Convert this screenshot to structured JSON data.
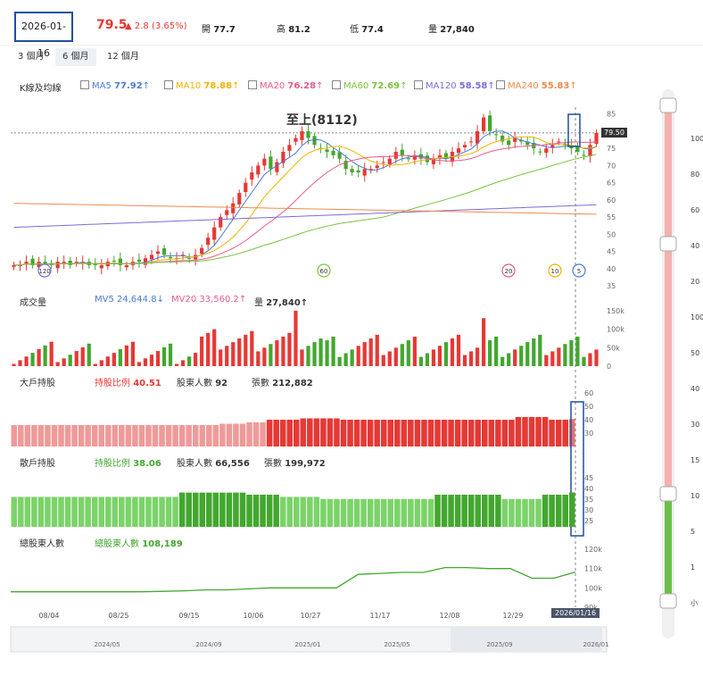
{
  "header": {
    "date": "2026-01-16",
    "price": "79.5",
    "change": "▲ 2.8 (3.65%)",
    "open_label": "開",
    "open": "77.7",
    "high_label": "高",
    "high": "81.2",
    "low_label": "低",
    "low": "77.4",
    "vol_label": "量",
    "volume": "27,840"
  },
  "tabs": [
    "3 個月",
    "6 個月",
    "12 個月"
  ],
  "active_tab": 1,
  "kline": {
    "label": "K線及均線",
    "ma": [
      {
        "name": "MA5",
        "value": "77.92",
        "arrow": "↑",
        "color": "#4a7bd6"
      },
      {
        "name": "MA10",
        "value": "78.88",
        "arrow": "↑",
        "color": "#f0b400"
      },
      {
        "name": "MA20",
        "value": "76.28",
        "arrow": "↑",
        "color": "#e85a8a"
      },
      {
        "name": "MA60",
        "value": "72.69",
        "arrow": "↑",
        "color": "#7cc23f"
      },
      {
        "name": "MA120",
        "value": "58.58",
        "arrow": "↑",
        "color": "#7d6bd9"
      },
      {
        "name": "MA240",
        "value": "55.83",
        "arrow": "↑",
        "color": "#f08a4b"
      }
    ],
    "annotation": "至上(8112)",
    "price_tag": "79.50",
    "yticks": [
      "85",
      "80",
      "75",
      "70",
      "65",
      "60",
      "55",
      "50",
      "45",
      "40",
      "35"
    ],
    "markers": [
      "120",
      "60",
      "20",
      "10",
      "5"
    ]
  },
  "volume": {
    "label": "成交量",
    "mv5_label": "MV5",
    "mv5": "24,644.8↓",
    "mv20_label": "MV20",
    "mv20": "33,560.2↑",
    "vol_label": "量",
    "vol": "27,840↑",
    "yticks": [
      "150k",
      "100k",
      "50k",
      "0"
    ]
  },
  "big": {
    "label": "大戶持股",
    "ratio_label": "持股比例",
    "ratio": "40.51",
    "holders_label": "股東人數",
    "holders": "92",
    "shares_label": "張數",
    "shares": "212,882",
    "yticks": [
      "60",
      "50",
      "40",
      "30"
    ]
  },
  "retail": {
    "label": "散戶持股",
    "ratio_label": "持股比例",
    "ratio": "38.06",
    "holders_label": "股東人數",
    "holders": "66,556",
    "shares_label": "張數",
    "shares": "199,972",
    "yticks": [
      "45",
      "40",
      "35",
      "30",
      "25"
    ]
  },
  "total": {
    "label": "總股東人數",
    "count_label": "總股東人數",
    "count": "108,189",
    "yticks": [
      "120k",
      "110k",
      "100k",
      "90k"
    ]
  },
  "xaxis": [
    "08/04",
    "08/25",
    "09/15",
    "10/06",
    "10/27",
    "11/17",
    "12/08",
    "12/29"
  ],
  "xaxis_current": "2026/01/16",
  "navigator": [
    "2024/05",
    "2024/09",
    "2025/01",
    "2025/05",
    "2025/09",
    "2026/01"
  ],
  "slider_ticks": [
    "100",
    "80",
    "60",
    "40",
    "20",
    "100",
    "50",
    "40",
    "30",
    "15",
    "10",
    "5",
    "1",
    "小"
  ],
  "chart_data": {
    "type": "candlestick",
    "title": "",
    "ylim": [
      35,
      87
    ],
    "price_series": [
      41,
      41,
      42,
      41,
      42,
      41,
      41,
      42,
      42,
      41,
      42,
      42,
      41,
      41,
      41,
      42,
      42,
      41,
      41,
      42,
      42,
      43,
      44,
      45,
      44,
      43,
      43,
      44,
      43,
      44,
      46,
      49,
      52,
      55,
      57,
      59,
      62,
      65,
      68,
      70,
      72,
      69,
      71,
      74,
      76,
      78,
      80,
      78,
      76,
      75,
      74,
      73,
      72,
      69,
      68,
      68,
      69,
      69,
      70,
      71,
      72,
      74,
      73,
      72,
      73,
      72,
      71,
      72,
      73,
      72,
      74,
      75,
      76,
      77,
      80,
      84,
      80,
      79,
      77,
      76,
      78,
      77,
      76,
      75,
      74,
      75,
      76,
      77,
      76,
      75,
      74,
      73,
      76,
      79.5
    ],
    "ma_values": {
      "MA5": 77.92,
      "MA10": 78.88,
      "MA20": 76.28,
      "MA60": 72.69,
      "MA120": 58.58,
      "MA240": 55.83
    },
    "volume_ylim": [
      0,
      150000
    ],
    "big_holder_ratio": [
      36,
      36,
      36,
      36,
      36,
      36,
      36,
      36,
      36,
      36,
      36,
      36,
      36,
      36,
      36,
      36,
      36,
      36,
      36,
      36,
      36,
      36,
      36,
      36,
      36,
      36,
      36,
      36,
      36,
      36,
      36,
      37,
      37,
      37,
      37,
      38,
      38,
      38,
      40,
      40,
      40,
      40,
      40,
      41,
      41,
      41,
      41,
      41,
      41,
      40,
      40,
      40,
      40,
      40,
      40,
      40,
      40,
      40,
      40,
      40,
      40,
      40,
      40,
      40,
      40,
      40,
      40,
      40,
      40,
      40,
      40,
      40,
      40,
      40,
      40,
      42,
      42,
      42,
      42,
      42,
      40,
      40,
      40,
      40.51
    ],
    "retail_ratio": [
      36,
      36,
      36,
      36,
      36,
      36,
      36,
      36,
      36,
      36,
      36,
      36,
      36,
      36,
      36,
      36,
      36,
      36,
      36,
      36,
      36,
      36,
      36,
      36,
      36,
      38,
      38,
      38,
      38,
      38,
      38,
      38,
      38,
      38,
      38,
      37,
      37,
      37,
      37,
      37,
      36,
      36,
      36,
      36,
      36,
      36,
      35,
      35,
      35,
      35,
      35,
      35,
      35,
      35,
      35,
      35,
      35,
      35,
      35,
      35,
      35,
      35,
      35,
      37,
      37,
      37,
      37,
      37,
      37,
      37,
      37,
      37,
      37,
      35,
      35,
      35,
      35,
      35,
      35,
      37,
      37,
      37,
      37,
      38.06
    ],
    "total_holders_ylim": [
      90000,
      120000
    ],
    "total_holders_current": 108189
  }
}
